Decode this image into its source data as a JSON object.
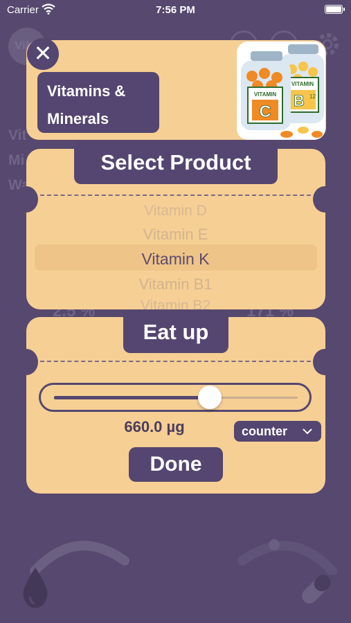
{
  "status_bar": {
    "carrier": "Carrier",
    "time": "7:56 PM"
  },
  "background": {
    "logo_text": "ViM",
    "labels": [
      "Vit",
      "Mi",
      "Wa"
    ],
    "left_percent": "2.5 %",
    "right_percent": "171 %"
  },
  "header": {
    "title": "Vitamins & Minerals",
    "close_label": "✕"
  },
  "logo": {
    "bottle_c_text": "VITAMIN C",
    "bottle_b_text": "VITAMIN B12"
  },
  "select_product": {
    "title": "Select Product",
    "items": [
      "Vitamin D",
      "Vitamin E",
      "Vitamin K",
      "Vitamin B1",
      "Vitamin B2"
    ],
    "selected_index": 2
  },
  "eat_up": {
    "title": "Eat up",
    "slider_value_fraction": 0.66,
    "amount": "660.0 µg",
    "unit_selected": "counter",
    "done_label": "Done"
  },
  "colors": {
    "background": "#56486e",
    "card": "#f6cf94",
    "accent": "#544670"
  }
}
